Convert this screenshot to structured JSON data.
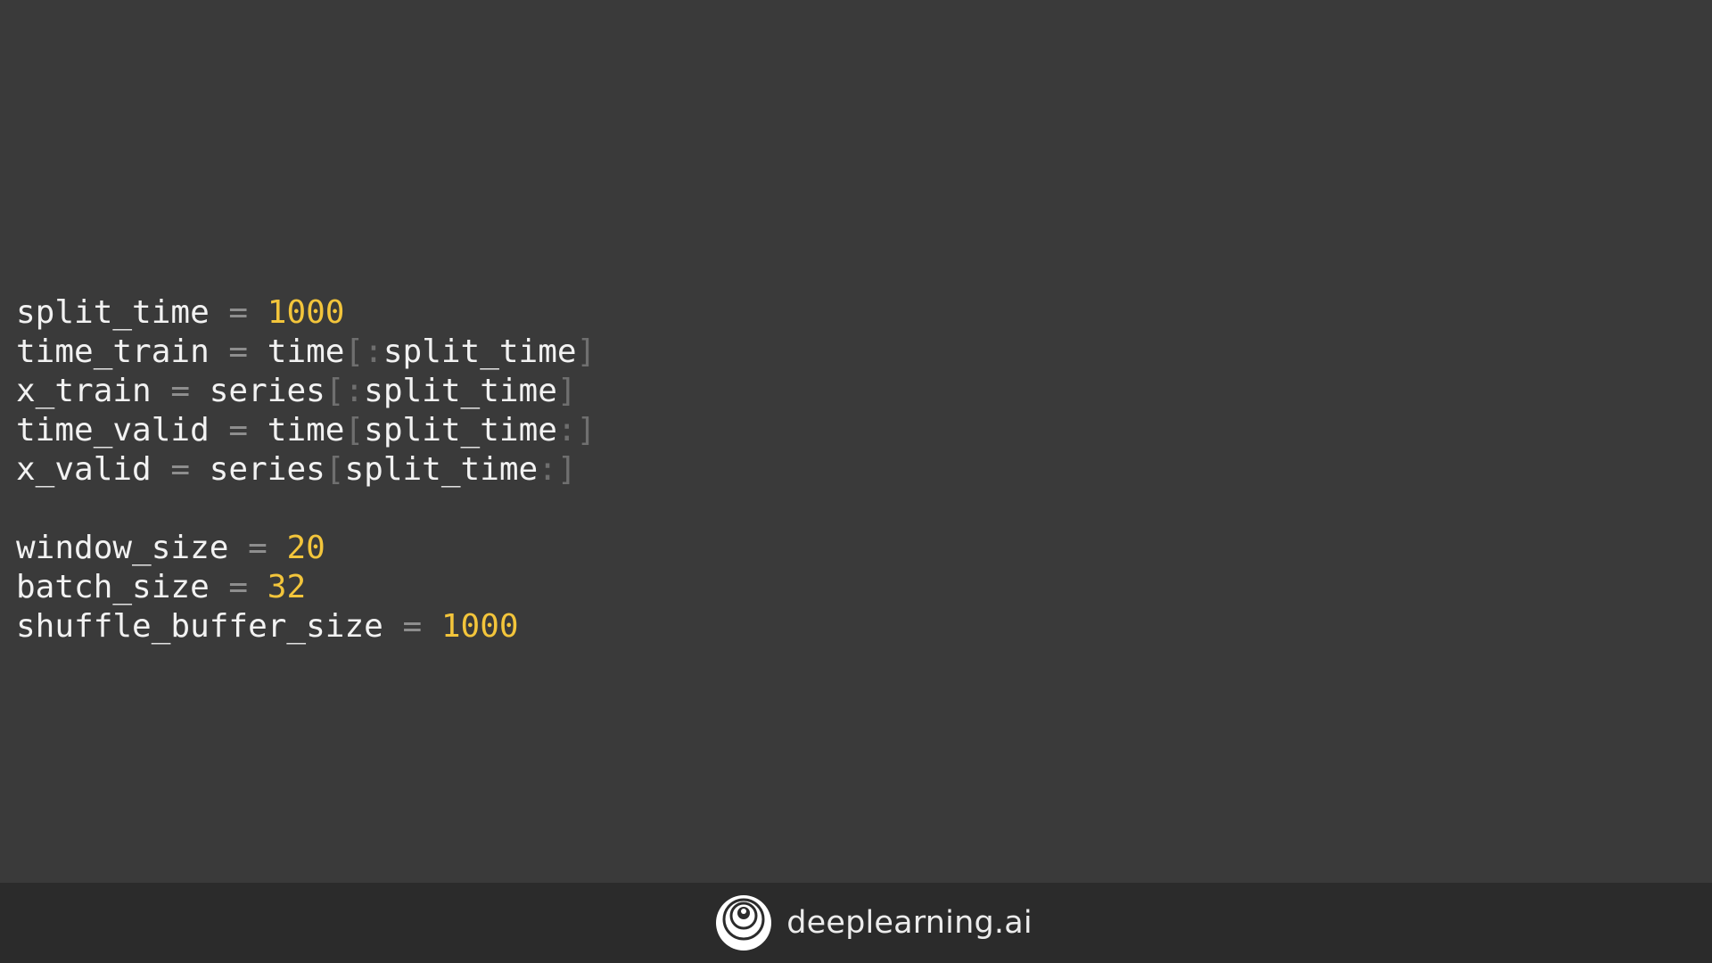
{
  "code": {
    "lines": [
      {
        "tokens": [
          {
            "type": "id",
            "text": "split_time"
          },
          {
            "type": "op",
            "text": " = "
          },
          {
            "type": "num",
            "text": "1000"
          }
        ]
      },
      {
        "tokens": [
          {
            "type": "id",
            "text": "time_train"
          },
          {
            "type": "op",
            "text": " = "
          },
          {
            "type": "id",
            "text": "time"
          },
          {
            "type": "punct",
            "text": "[:"
          },
          {
            "type": "id",
            "text": "split_time"
          },
          {
            "type": "punct",
            "text": "]"
          }
        ]
      },
      {
        "tokens": [
          {
            "type": "id",
            "text": "x_train"
          },
          {
            "type": "op",
            "text": " = "
          },
          {
            "type": "id",
            "text": "series"
          },
          {
            "type": "punct",
            "text": "[:"
          },
          {
            "type": "id",
            "text": "split_time"
          },
          {
            "type": "punct",
            "text": "]"
          }
        ]
      },
      {
        "tokens": [
          {
            "type": "id",
            "text": "time_valid"
          },
          {
            "type": "op",
            "text": " = "
          },
          {
            "type": "id",
            "text": "time"
          },
          {
            "type": "punct",
            "text": "["
          },
          {
            "type": "id",
            "text": "split_time"
          },
          {
            "type": "punct",
            "text": ":]"
          }
        ]
      },
      {
        "tokens": [
          {
            "type": "id",
            "text": "x_valid"
          },
          {
            "type": "op",
            "text": " = "
          },
          {
            "type": "id",
            "text": "series"
          },
          {
            "type": "punct",
            "text": "["
          },
          {
            "type": "id",
            "text": "split_time"
          },
          {
            "type": "punct",
            "text": ":]"
          }
        ]
      },
      {
        "tokens": []
      },
      {
        "tokens": [
          {
            "type": "id",
            "text": "window_size"
          },
          {
            "type": "op",
            "text": " = "
          },
          {
            "type": "num",
            "text": "20"
          }
        ]
      },
      {
        "tokens": [
          {
            "type": "id",
            "text": "batch_size"
          },
          {
            "type": "op",
            "text": " = "
          },
          {
            "type": "num",
            "text": "32"
          }
        ]
      },
      {
        "tokens": [
          {
            "type": "id",
            "text": "shuffle_buffer_size"
          },
          {
            "type": "op",
            "text": " = "
          },
          {
            "type": "num",
            "text": "1000"
          }
        ]
      }
    ]
  },
  "footer": {
    "brand_name": "deeplearning.ai",
    "logo_icon": "deeplearning-ai-logo-icon"
  },
  "colors": {
    "background": "#3a3a3a",
    "footer_background": "#2b2b2b",
    "identifier": "#f2f2f2",
    "operator": "#8e8e8e",
    "number": "#f3c53b",
    "punctuation": "#6f6f6f"
  }
}
